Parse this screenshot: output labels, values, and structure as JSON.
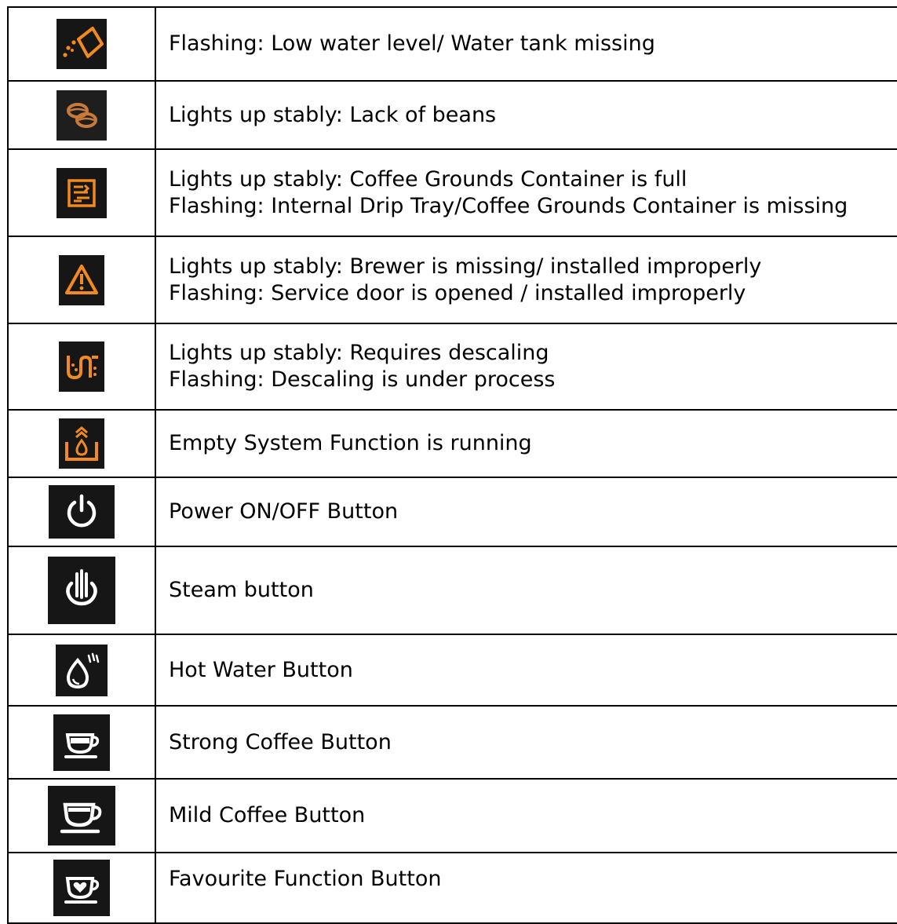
{
  "table": {
    "rows": [
      {
        "icon": "water-tank-icon",
        "lines": [
          "Flashing: Low water level/ Water tank missing"
        ]
      },
      {
        "icon": "coffee-beans-icon",
        "lines": [
          "Lights up stably: Lack of beans"
        ]
      },
      {
        "icon": "grounds-container-icon",
        "lines": [
          "Lights up stably: Coffee Grounds Container is full",
          "Flashing: Internal Drip Tray/Coffee Grounds Container is missing"
        ]
      },
      {
        "icon": "warning-triangle-icon",
        "lines": [
          "Lights up stably: Brewer is missing/ installed improperly",
          "Flashing: Service door is opened / installed improperly"
        ]
      },
      {
        "icon": "descaling-icon",
        "lines": [
          "Lights up stably: Requires descaling",
          "Flashing: Descaling is under process"
        ]
      },
      {
        "icon": "empty-system-icon",
        "lines": [
          "Empty System Function is running"
        ]
      },
      {
        "icon": "power-icon",
        "lines": [
          "Power ON/OFF Button"
        ]
      },
      {
        "icon": "steam-icon",
        "lines": [
          "Steam button"
        ]
      },
      {
        "icon": "hot-water-icon",
        "lines": [
          "Hot Water Button"
        ]
      },
      {
        "icon": "strong-coffee-icon",
        "lines": [
          "Strong Coffee Button"
        ]
      },
      {
        "icon": "mild-coffee-icon",
        "lines": [
          "Mild Coffee Button"
        ]
      },
      {
        "icon": "favourite-icon",
        "lines": [
          "Favourite Function Button"
        ]
      }
    ]
  },
  "colors": {
    "orange": "#f28a1e",
    "icon_bg": "#161616",
    "white": "#ffffff"
  }
}
